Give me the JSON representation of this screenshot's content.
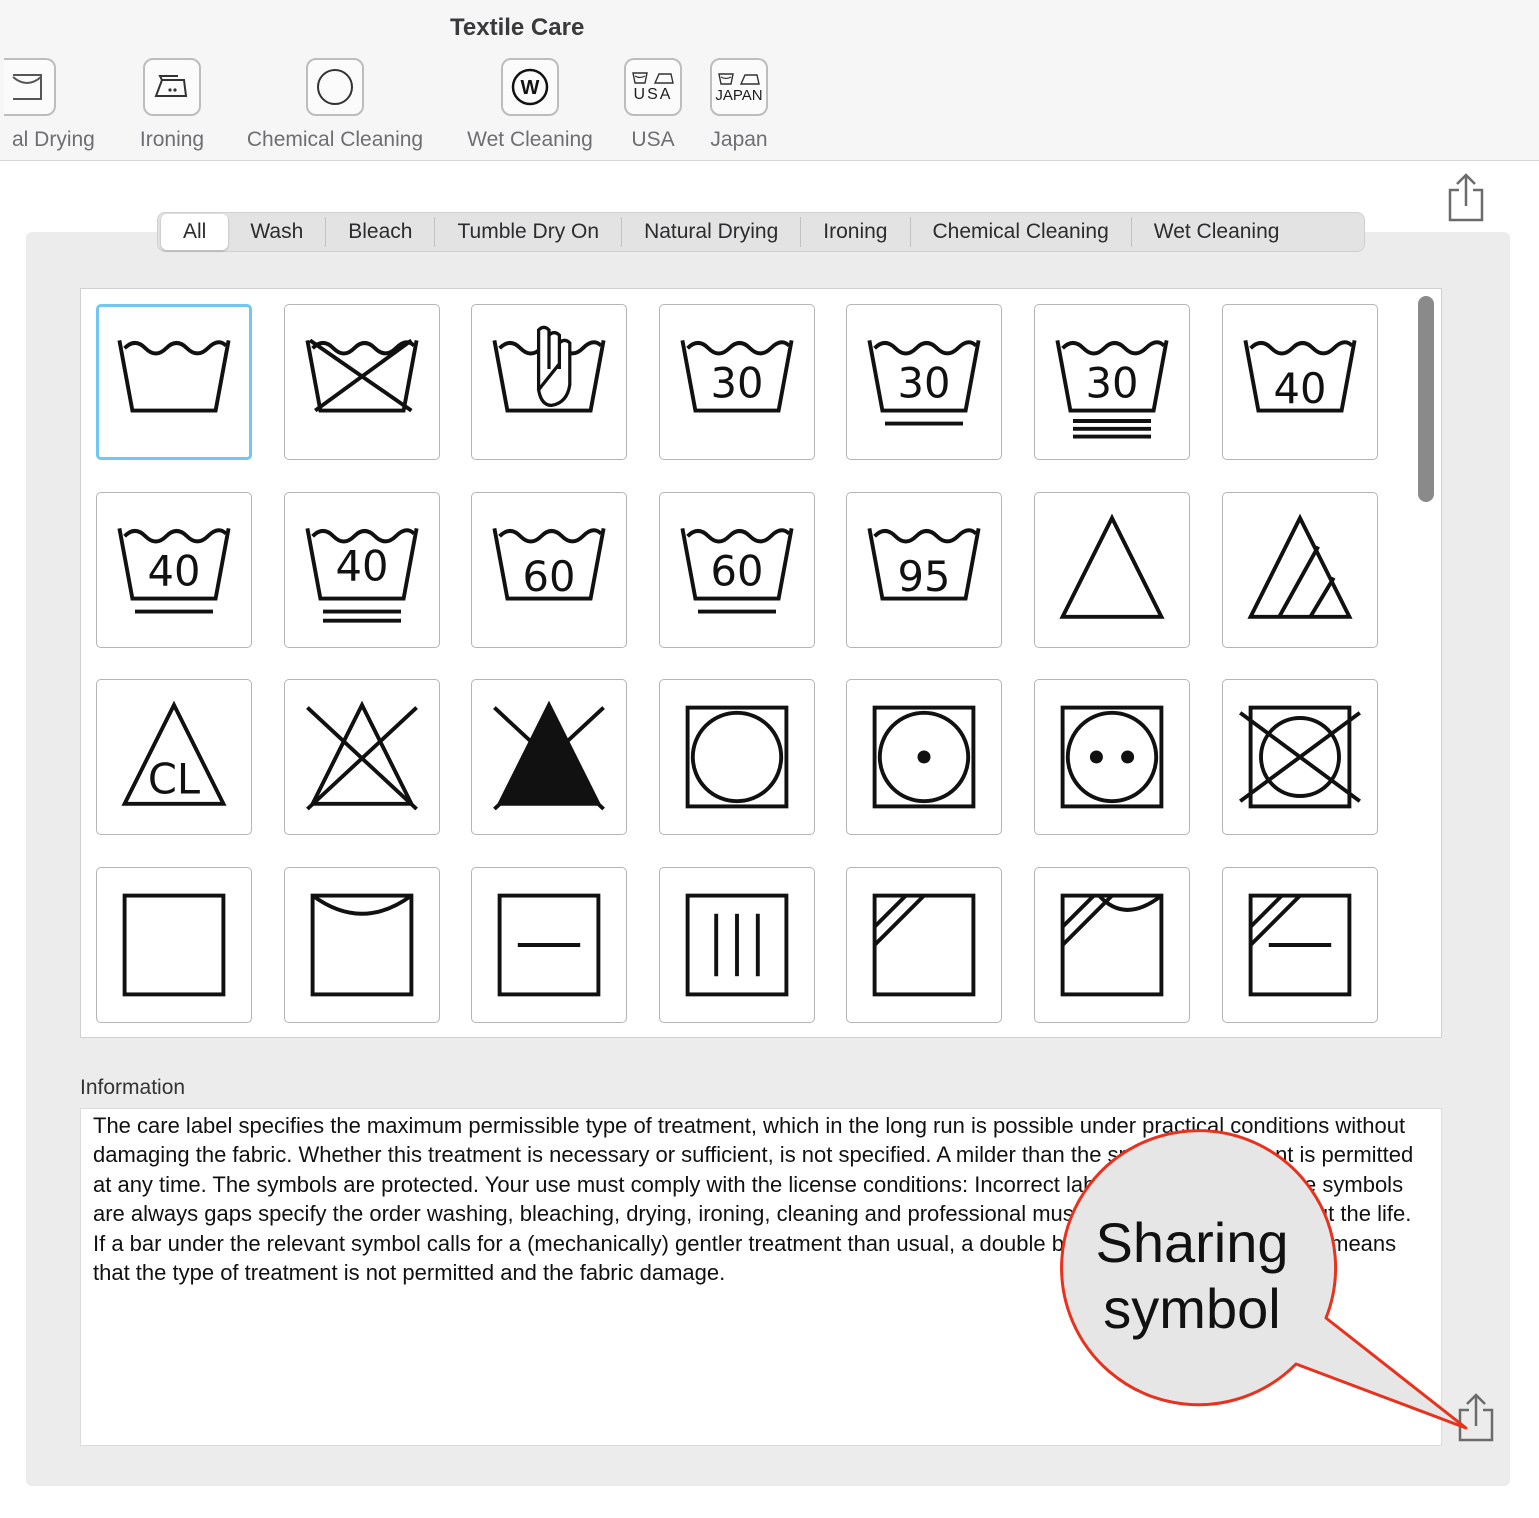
{
  "window": {
    "title": "Textile Care"
  },
  "toolbar": {
    "items": [
      {
        "label": "al Drying",
        "icon": "natural-drying-icon"
      },
      {
        "label": "Ironing",
        "icon": "iron-icon"
      },
      {
        "label": "Chemical Cleaning",
        "icon": "circle-icon"
      },
      {
        "label": "Wet Cleaning",
        "icon": "wet-cleaning-w-icon"
      },
      {
        "label": "USA",
        "icon": "usa-label-icon",
        "badge": "USA"
      },
      {
        "label": "Japan",
        "icon": "japan-label-icon",
        "badge": "JAPAN"
      }
    ]
  },
  "filter": {
    "segments": [
      "All",
      "Wash",
      "Bleach",
      "Tumble Dry On",
      "Natural Drying",
      "Ironing",
      "Chemical Cleaning",
      "Wet Cleaning"
    ],
    "selected": "All"
  },
  "symbols": [
    {
      "icon": "wash-icon",
      "text": ""
    },
    {
      "icon": "do-not-wash-icon",
      "text": ""
    },
    {
      "icon": "hand-wash-icon",
      "text": ""
    },
    {
      "icon": "wash-30-icon",
      "text": "30"
    },
    {
      "icon": "wash-30-gentle-icon",
      "text": "30"
    },
    {
      "icon": "wash-30-very-gentle-icon",
      "text": "30"
    },
    {
      "icon": "wash-40-icon",
      "text": "40"
    },
    {
      "icon": "wash-40-gentle-icon",
      "text": "40"
    },
    {
      "icon": "wash-40-very-gentle-icon",
      "text": "40"
    },
    {
      "icon": "wash-60-icon",
      "text": "60"
    },
    {
      "icon": "wash-60-gentle-icon",
      "text": "60"
    },
    {
      "icon": "wash-95-icon",
      "text": "95"
    },
    {
      "icon": "bleach-allowed-icon",
      "text": ""
    },
    {
      "icon": "oxygen-bleach-only-icon",
      "text": ""
    },
    {
      "icon": "chlorine-bleach-icon",
      "text": "CL"
    },
    {
      "icon": "do-not-bleach-icon",
      "text": ""
    },
    {
      "icon": "do-not-bleach-filled-icon",
      "text": ""
    },
    {
      "icon": "tumble-dry-icon",
      "text": ""
    },
    {
      "icon": "tumble-dry-low-icon",
      "text": ""
    },
    {
      "icon": "tumble-dry-normal-icon",
      "text": ""
    },
    {
      "icon": "do-not-tumble-dry-icon",
      "text": ""
    },
    {
      "icon": "natural-dry-icon",
      "text": ""
    },
    {
      "icon": "line-dry-icon",
      "text": ""
    },
    {
      "icon": "dry-flat-icon",
      "text": ""
    },
    {
      "icon": "drip-dry-icon",
      "text": ""
    },
    {
      "icon": "dry-in-shade-icon",
      "text": ""
    },
    {
      "icon": "line-dry-in-shade-icon",
      "text": ""
    },
    {
      "icon": "dry-flat-in-shade-icon",
      "text": ""
    }
  ],
  "information": {
    "label": "Information",
    "text": "The care label specifies the maximum permissible type of treatment, which in the long run is possible under practical conditions without damaging the fabric. Whether this treatment is necessary or sufficient, is not specified. A milder than the specified treatment is permitted at any time. The symbols are protected. Your use must comply with the license conditions: Incorrect labeling is prohibited. The symbols are always gaps specify the order washing, bleaching, drying, ironing, cleaning and professional must remain legible throughout the life. If a bar under the relevant symbol calls for a (mechanically) gentler treatment than usual, a double bar a very gentle. The cross means that the type of treatment is not permitted and the fabric damage."
  },
  "callout": {
    "line1": "Sharing",
    "line2": "symbol",
    "color": "#e8321e",
    "fill": "#e6e6e6"
  },
  "colors": {
    "selection": "#72c6f2"
  }
}
